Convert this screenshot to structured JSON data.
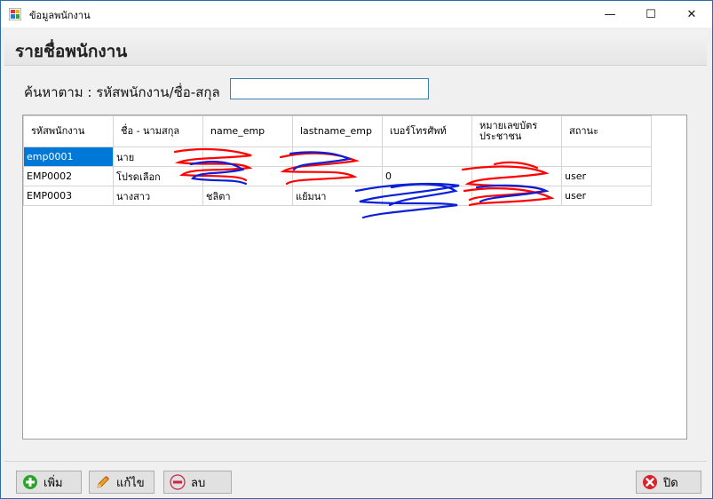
{
  "window": {
    "title": "ข้อมูลพนักงาน",
    "controls": {
      "minimize": "—",
      "maximize": "☐",
      "close": "✕"
    }
  },
  "header": {
    "title": "รายชื่อพนักงาน"
  },
  "search": {
    "label": "ค้นหาตาม : รหัสพนักงาน/ชื่อ-สกุล",
    "value": ""
  },
  "table": {
    "columns": [
      "รหัสพนักงาน",
      "ชื่อ - นามสกุล",
      "name_emp",
      "lastname_emp",
      "เบอร์โทรศัพท์",
      "หมายเลขบัตรประชาชน",
      "สถานะ"
    ],
    "rows": [
      [
        "emp0001",
        "นาย",
        "",
        "",
        "",
        "",
        ""
      ],
      [
        "EMP0002",
        "โปรดเลือก",
        "",
        "",
        "0",
        "",
        "user"
      ],
      [
        "EMP0003",
        "นางสาว",
        "ชลิตา",
        "แย้มนา",
        "",
        "",
        "user"
      ]
    ],
    "selected_cell": "emp0001"
  },
  "buttons": {
    "add": "เพิ่ม",
    "edit": "แก้ไข",
    "delete": "ลบ",
    "close": "ปิด"
  },
  "colors": {
    "selection": "#0078d7",
    "scribble_red": "#ff0000",
    "scribble_blue": "#0a1fd8",
    "add_icon": "#2aa52a",
    "delete_icon": "#e0e0e0",
    "close_icon": "#d9232b"
  },
  "icons": [
    "app-icon",
    "minimize-icon",
    "maximize-icon",
    "close-icon",
    "add-icon",
    "pencil-icon",
    "minus-icon",
    "cancel-icon"
  ]
}
